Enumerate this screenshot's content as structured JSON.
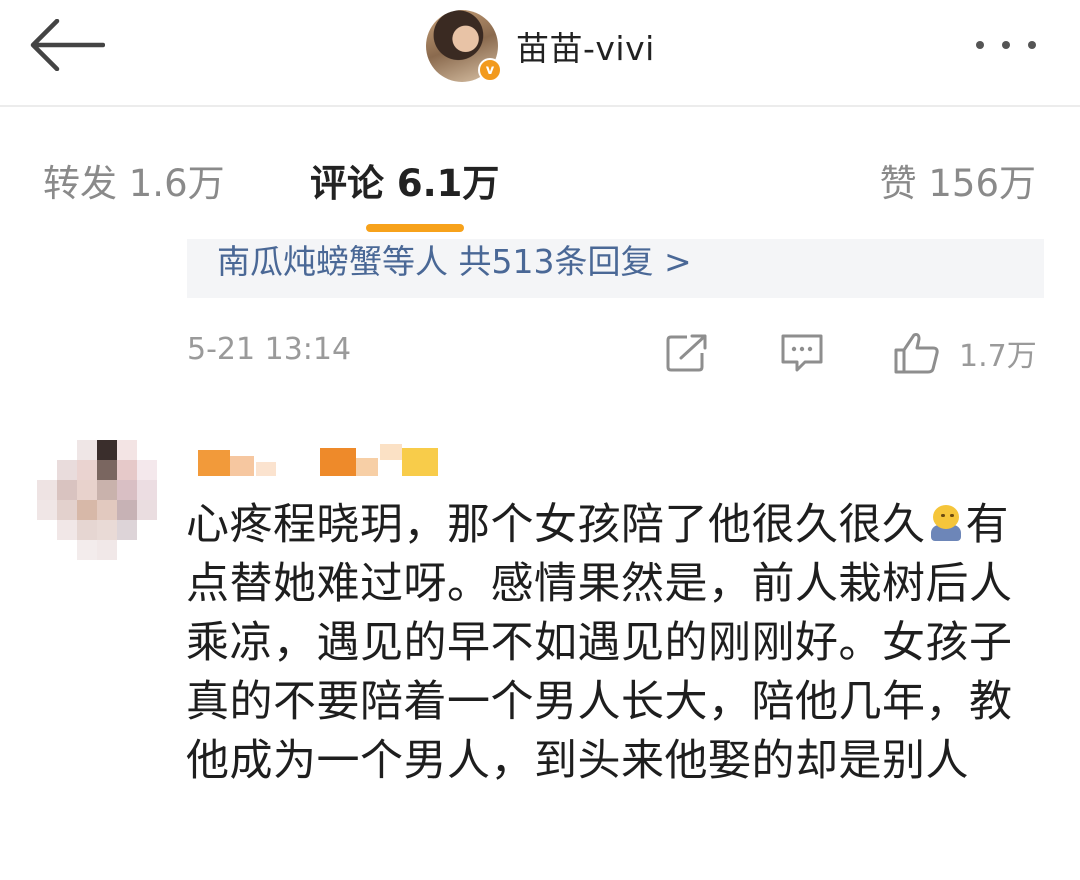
{
  "header": {
    "username": "苗苗-vivi",
    "verified_badge": "v",
    "icons": [
      "back-arrow-icon",
      "verified-badge-icon",
      "more-dots-icon"
    ]
  },
  "tabs": {
    "repost": "转发 1.6万",
    "comment": "评论 6.1万",
    "like": "赞 156万",
    "active": "comment"
  },
  "previous_comment": {
    "reply_summary": "南瓜炖螃蟹等人 共513条回复 >",
    "timestamp": "5-21 13:14",
    "like_count": "1.7万",
    "icons": [
      "share-icon",
      "comment-icon",
      "thumbs-up-icon"
    ]
  },
  "comment": {
    "avatar_blurred": true,
    "name_blurred": true,
    "text_part1": "心疼程晓玥，那个女孩陪了他很久很久",
    "emoji": "sad-emoji-icon",
    "text_part2": "有点替她难过呀。感情果然是，前人栽树后人乘凉，遇见的早不如遇见的刚刚好。女孩子真的不要陪着一个男人长大，陪他几年，教他成为一个男人，到头来他娶的却是别人"
  },
  "colors": {
    "accent": "#f7a21b",
    "link": "#4a6896",
    "muted": "#9a9a9a",
    "verified": "#f29a1e"
  }
}
